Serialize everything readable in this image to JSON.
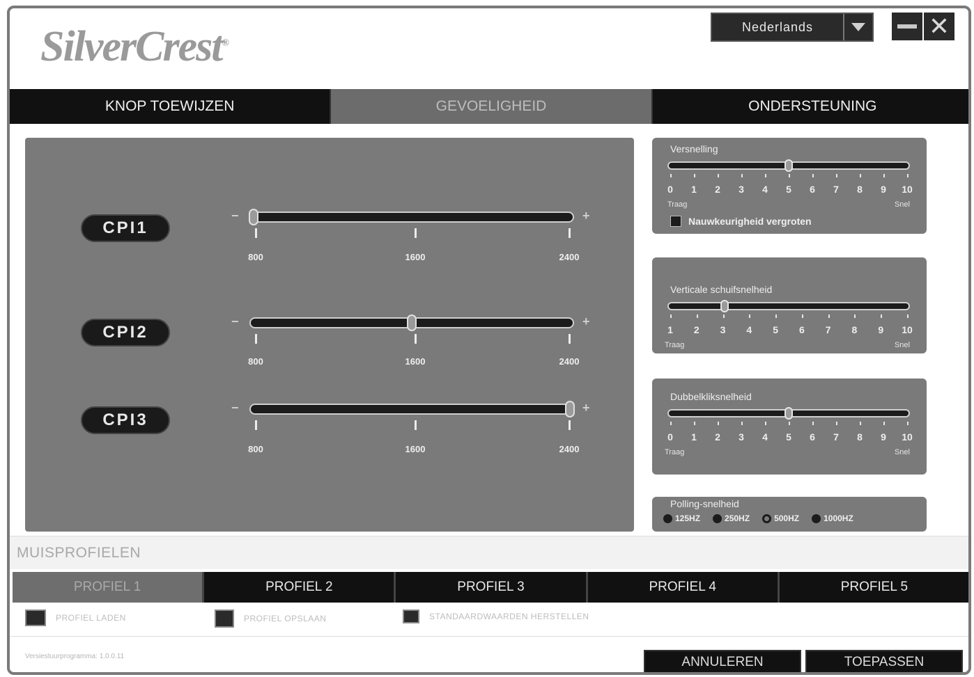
{
  "brand": {
    "logo_text": "SilverCrest"
  },
  "language": {
    "selected": "Nederlands"
  },
  "tabs": [
    {
      "label": "KNOP TOEWIJZEN",
      "active": false
    },
    {
      "label": "GEVOELIGHEID",
      "active": true
    },
    {
      "label": "ONDERSTEUNING",
      "active": false
    }
  ],
  "cpi": {
    "minus": "−",
    "plus": "+",
    "ticks": [
      "800",
      "1600",
      "2400"
    ],
    "range": [
      800,
      2400
    ],
    "rows": [
      {
        "label": "CPI1",
        "value": 800,
        "ticks": [
          "800",
          "1600",
          "2400"
        ]
      },
      {
        "label": "CPI2",
        "value": 1600,
        "ticks": [
          "800",
          "1600",
          "2400"
        ]
      },
      {
        "label": "CPI3",
        "value": 2400,
        "ticks": [
          "800",
          "1600",
          "2400"
        ]
      }
    ]
  },
  "acceleration": {
    "title": "Versnelling",
    "value": 5,
    "scale": [
      "0",
      "1",
      "2",
      "3",
      "4",
      "5",
      "6",
      "7",
      "8",
      "9",
      "10"
    ],
    "low": "Traag",
    "high": "Snel",
    "checkbox_label": "Nauwkeurigheid vergroten",
    "checked": false
  },
  "vertical_scroll": {
    "title": "Verticale schuifsnelheid",
    "value": 3,
    "scale": [
      "1",
      "2",
      "3",
      "4",
      "5",
      "6",
      "7",
      "8",
      "9",
      "10"
    ],
    "low": "Traag",
    "high": "Snel"
  },
  "double_click": {
    "title": "Dubbelkliksnelheid",
    "value": 5,
    "scale": [
      "0",
      "1",
      "2",
      "3",
      "4",
      "5",
      "6",
      "7",
      "8",
      "9",
      "10"
    ],
    "low": "Traag",
    "high": "Snel"
  },
  "polling": {
    "title": "Polling-snelheid",
    "options": [
      {
        "label": "125HZ",
        "selected": false
      },
      {
        "label": "250HZ",
        "selected": false
      },
      {
        "label": "500HZ",
        "selected": true
      },
      {
        "label": "1000HZ",
        "selected": false
      }
    ]
  },
  "profiles": {
    "section_label": "MUISPROFIELEN",
    "tabs": [
      {
        "label": "PROFIEL 1",
        "active": true
      },
      {
        "label": "PROFIEL 2",
        "active": false
      },
      {
        "label": "PROFIEL 3",
        "active": false
      },
      {
        "label": "PROFIEL 4",
        "active": false
      },
      {
        "label": "PROFIEL 5",
        "active": false
      }
    ],
    "actions": {
      "load": "PROFIEL LADEN",
      "save": "PROFIEL OPSLAAN",
      "reset": "STANDAARDWAARDEN HERSTELLEN"
    }
  },
  "footer": {
    "version": "Versiestuurprogramma: 1.0.0.11",
    "cancel": "ANNULEREN",
    "apply": "TOEPASSEN"
  }
}
